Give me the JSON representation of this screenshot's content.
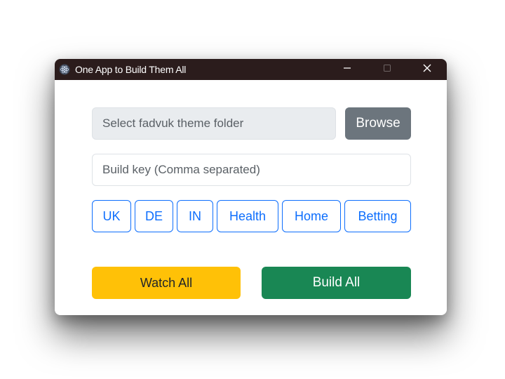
{
  "window": {
    "title": "One App to Build Them All",
    "app_icon": "electron-atom-icon",
    "controls": {
      "minimize": "minimize-icon",
      "maximize": "maximize-icon",
      "close": "close-icon"
    }
  },
  "folder": {
    "placeholder": "Select fadvuk theme folder",
    "value": "",
    "browse_label": "Browse"
  },
  "build_key": {
    "placeholder": "Build key (Comma separated)",
    "value": ""
  },
  "tags": [
    {
      "label": "UK"
    },
    {
      "label": "DE"
    },
    {
      "label": "IN"
    },
    {
      "label": "Health"
    },
    {
      "label": "Home"
    },
    {
      "label": "Betting"
    }
  ],
  "actions": {
    "watch_label": "Watch All",
    "build_label": "Build All"
  },
  "colors": {
    "titlebar": "#2b1c1c",
    "secondary": "#6c757d",
    "primary": "#0d6efd",
    "warning": "#ffc107",
    "success": "#198754"
  }
}
